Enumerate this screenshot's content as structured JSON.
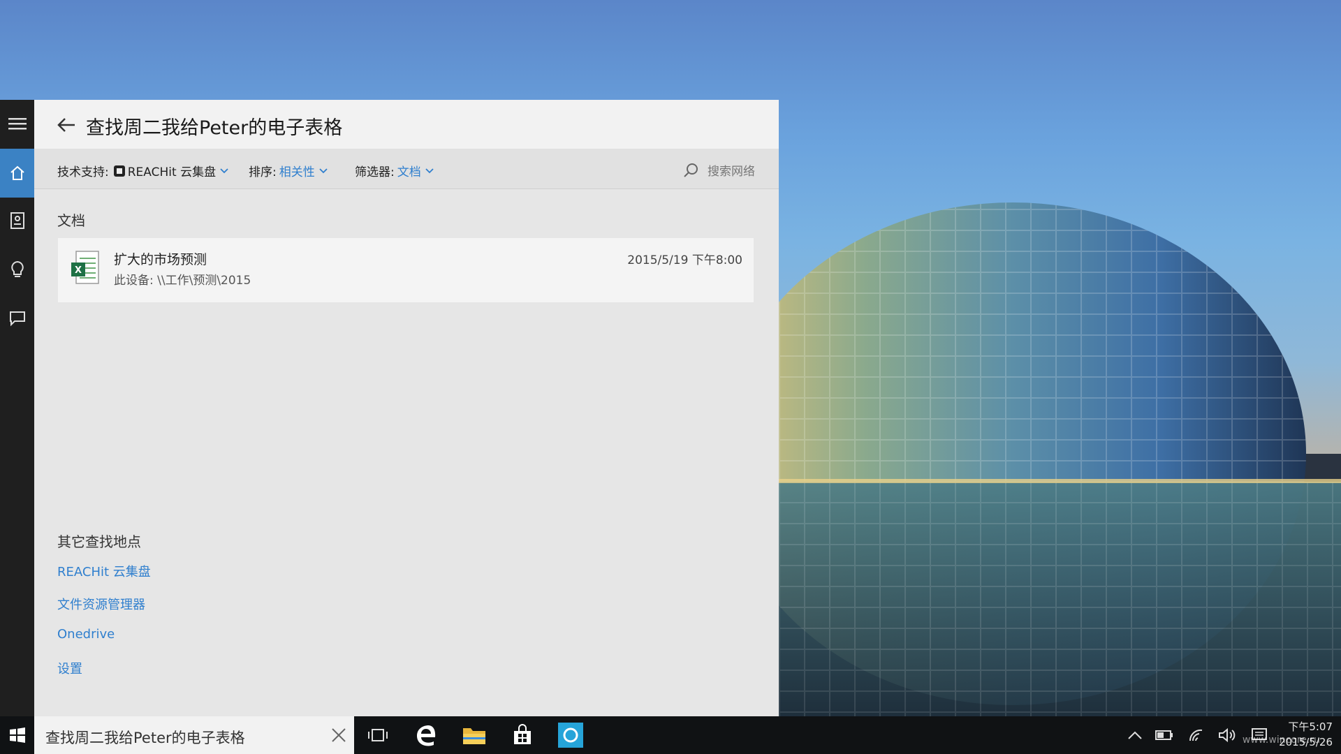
{
  "panel": {
    "title": "查找周二我给Peter的电子表格",
    "toolbar": {
      "source_label": "技术支持:",
      "source_value": "REACHit 云集盘",
      "sort_label": "排序:",
      "sort_value": "相关性",
      "filter_label": "筛选器:",
      "filter_value": "文档",
      "search_web": "搜索网络"
    },
    "section_docs": "文档",
    "result": {
      "name": "扩大的市场预测",
      "path": "此设备: \\\\工作\\预测\\2015",
      "date": "2015/5/19 下午8:00",
      "icon": "excel-file-icon"
    },
    "other_title": "其它查找地点",
    "other_links": [
      "REACHit 云集盘",
      "文件资源管理器",
      "Onedrive",
      "设置"
    ]
  },
  "rail": {
    "items": [
      "hamburger-icon",
      "home-icon",
      "notebook-icon",
      "lightbulb-icon",
      "feedback-icon"
    ]
  },
  "taskbar": {
    "search_text": "查找周二我给Peter的电子表格",
    "apps": [
      "task-view-icon",
      "edge-icon",
      "file-explorer-icon",
      "store-icon",
      "reachit-app-icon"
    ],
    "clock_time": "下午5:07",
    "clock_date": "2015/5/26"
  },
  "watermark": "www.wincore.ru",
  "colors": {
    "accent": "#2f7fce",
    "active_rail": "#3b82c4",
    "taskbar": "#101214",
    "panel": "#e6e6e6"
  }
}
